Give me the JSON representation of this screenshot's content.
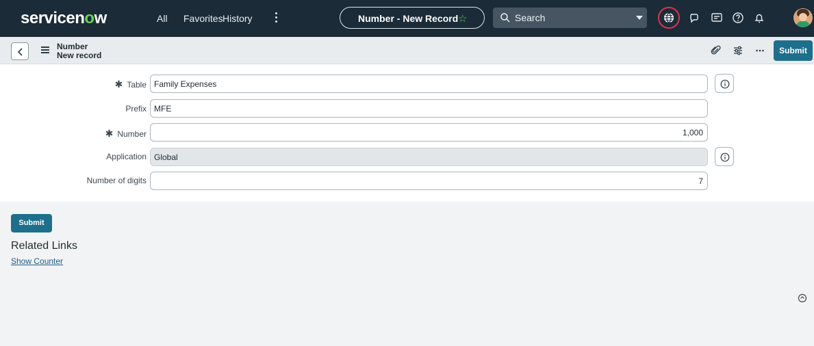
{
  "nav": {
    "logo_main": "servicen",
    "logo_o": "o",
    "logo_end": "w",
    "links": [
      "All",
      "Favorites",
      "History"
    ],
    "context_pill": "Number - New Record",
    "search_label": "Search",
    "icons": [
      "globe-icon",
      "chat-icon",
      "workspace-icon",
      "help-icon",
      "bell-icon",
      "user-avatar"
    ],
    "accent_color": "#62d84e",
    "highlight_color": "#e0334a"
  },
  "record_header": {
    "title": "Number",
    "subtitle": "New record",
    "submit_label": "Submit",
    "icons": [
      "attachment-icon",
      "settings-sliders-icon",
      "more-icon"
    ]
  },
  "form": {
    "table": {
      "label": "Table",
      "required": true,
      "value": "Family Expenses"
    },
    "prefix": {
      "label": "Prefix",
      "required": false,
      "value": "MFE"
    },
    "number": {
      "label": "Number",
      "required": true,
      "value": "1,000"
    },
    "application": {
      "label": "Application",
      "required": false,
      "value": "Global",
      "readonly": true
    },
    "digits": {
      "label": "Number of digits",
      "required": false,
      "value": "7"
    }
  },
  "footer": {
    "submit_label": "Submit",
    "related_links_heading": "Related Links",
    "show_counter_link": "Show Counter"
  },
  "colors": {
    "nav_bg": "#1b2b38",
    "primary_button": "#1d6f8c",
    "header_bg": "#e8ecef"
  }
}
